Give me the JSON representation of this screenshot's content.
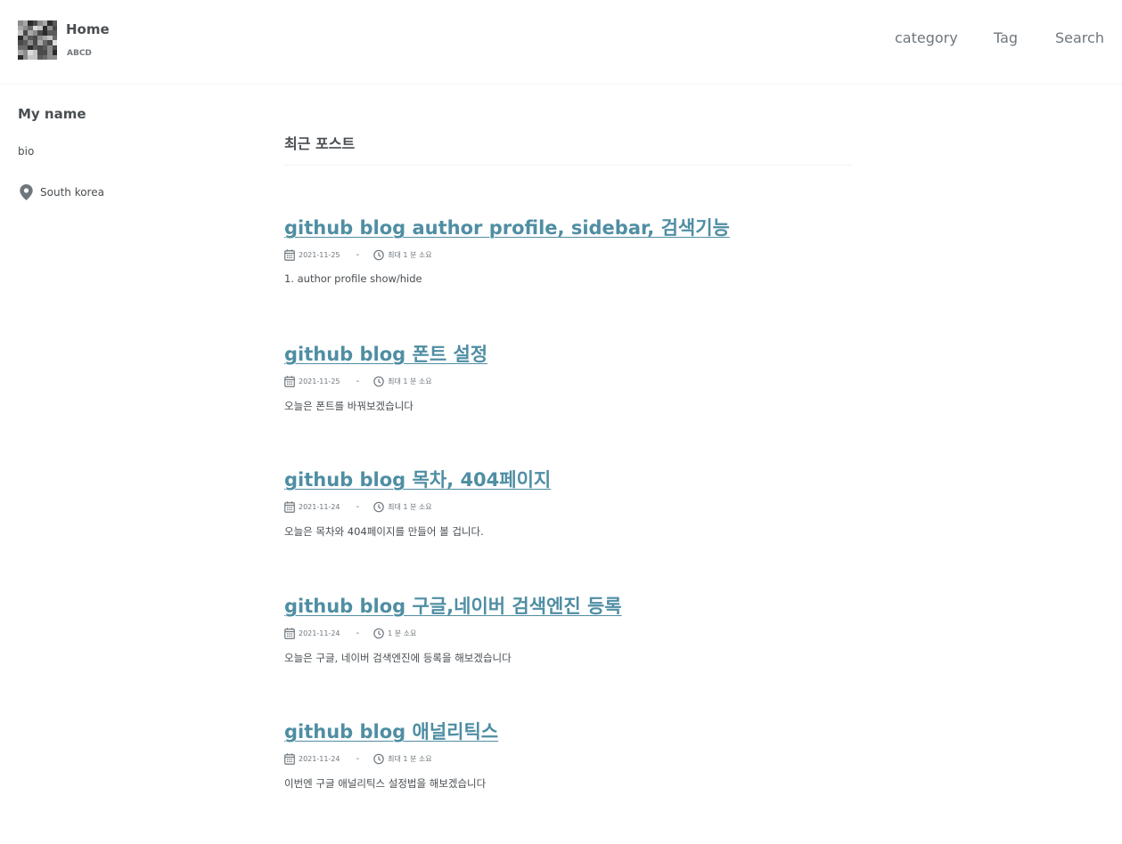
{
  "header": {
    "site_title": "Home",
    "site_subtitle": "ABCD",
    "nav": [
      {
        "label": "category"
      },
      {
        "label": "Tag"
      },
      {
        "label": "Search"
      }
    ]
  },
  "sidebar": {
    "author_name": "My name",
    "bio": "bio",
    "location": "South korea"
  },
  "main": {
    "archive_title": "최근 포스트",
    "posts": [
      {
        "title": "github blog author profile, sidebar, 검색기능",
        "date": "2021-11-25",
        "read_time": "최대 1 분 소요",
        "excerpt": "1. author profile show/hide"
      },
      {
        "title": "github blog 폰트 설정",
        "date": "2021-11-25",
        "read_time": "최대 1 분 소요",
        "excerpt": "오늘은 폰트를 바꿔보겠습니다"
      },
      {
        "title": "github blog 목차, 404페이지",
        "date": "2021-11-24",
        "read_time": "최대 1 분 소요",
        "excerpt": "오늘은 목차와 404페이지를 만들어 볼 겁니다."
      },
      {
        "title": "github blog 구글,네이버 검색엔진 등록",
        "date": "2021-11-24",
        "read_time": "1 분 소요",
        "excerpt": "오늘은 구글, 네이버 검색엔진에 등록을 해보겠습니다"
      },
      {
        "title": "github blog 애널리틱스",
        "date": "2021-11-24",
        "read_time": "최대 1 분 소요",
        "excerpt": "이번엔 구글 애널리틱스 설정법을 해보겠습니다"
      }
    ]
  },
  "colors": {
    "link": "#4f8ea3",
    "text": "#494e52",
    "muted": "#6f777d"
  },
  "icons": {
    "logo": "pixelated-avatar-image",
    "location": "map-marker-icon",
    "date": "calendar-icon",
    "read_time": "clock-icon"
  }
}
